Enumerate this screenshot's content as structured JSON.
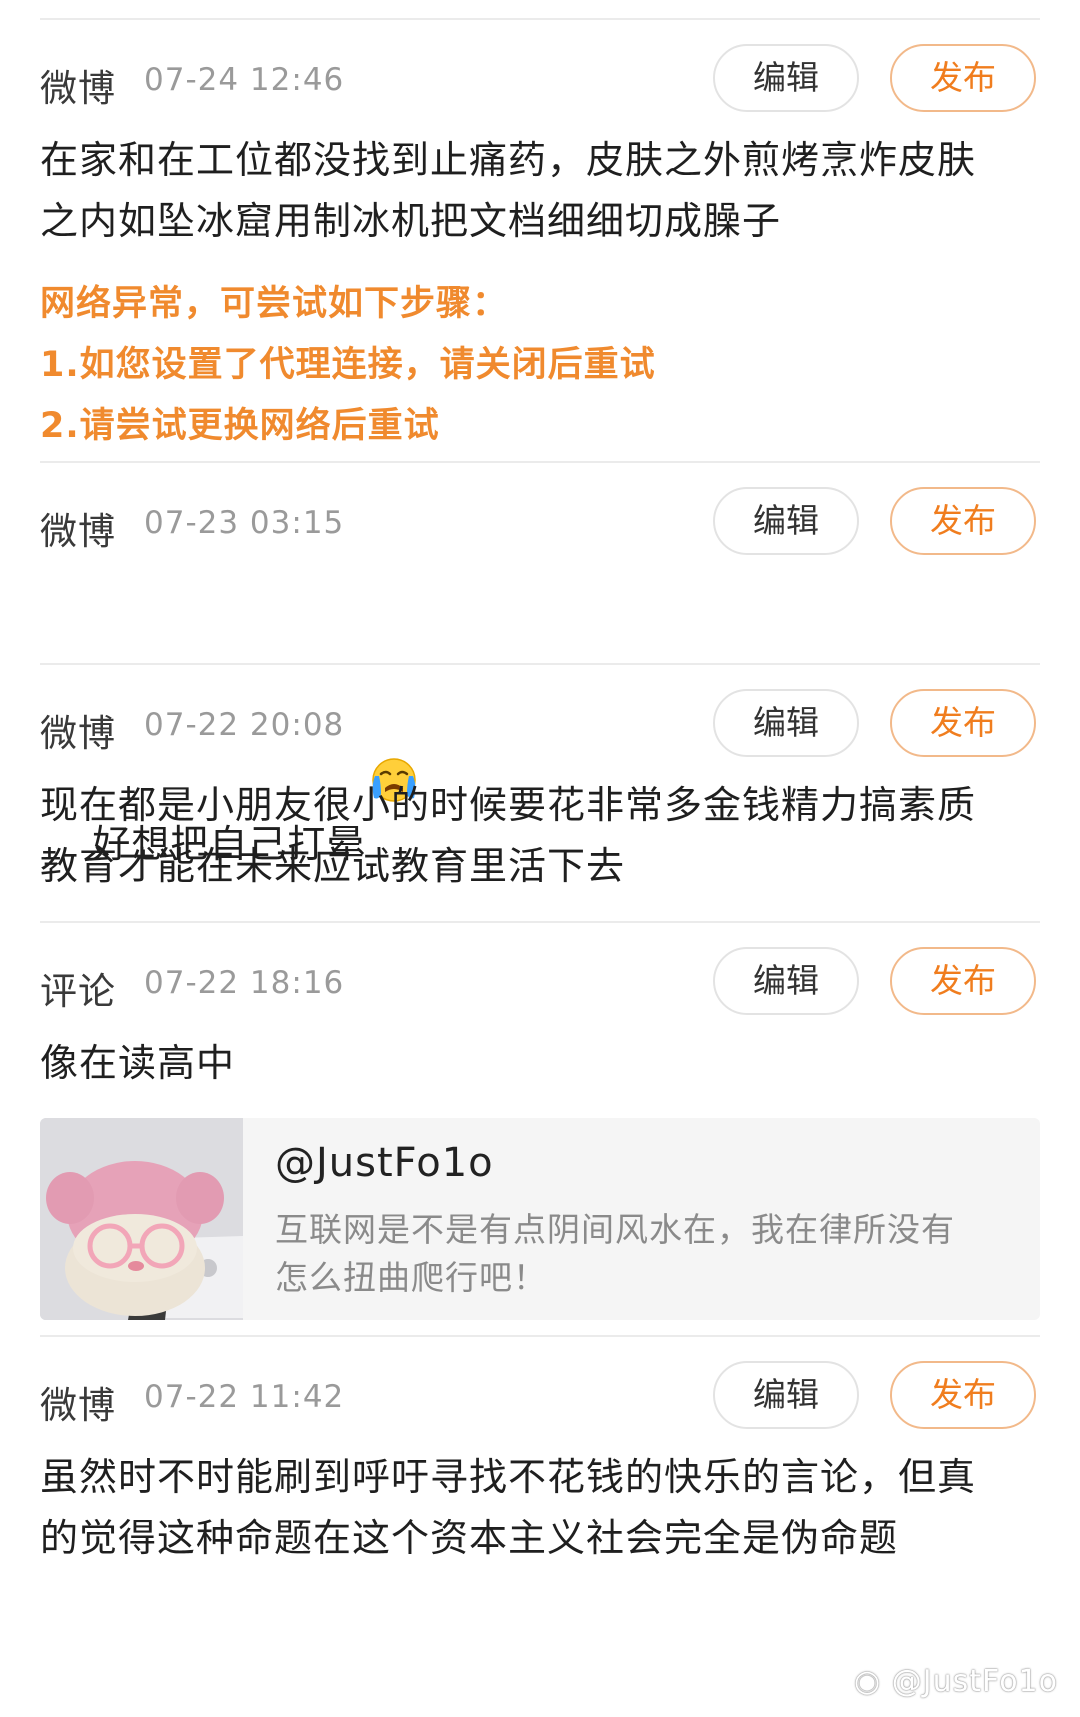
{
  "posts": [
    {
      "source": "微博",
      "time": "07-24 12:46",
      "edit_label": "编辑",
      "publish_label": "发布",
      "text": "在家和在工位都没找到止痛药，皮肤之外煎烤烹炸皮肤\n之内如坠冰窟用制冰机把文档细细切成臊子",
      "error": {
        "title": "网络异常，可尝试如下步骤：",
        "step1": "1.如您设置了代理连接，请关闭后重试",
        "step2": "2.请尝试更换网络后重试"
      }
    },
    {
      "source": "微博",
      "time": "07-23 03:15",
      "edit_label": "编辑",
      "publish_label": "发布",
      "text": "好想把自己打晕",
      "emoji": "crying-face-emoji"
    },
    {
      "source": "微博",
      "time": "07-22 20:08",
      "edit_label": "编辑",
      "publish_label": "发布",
      "text": "现在都是小朋友很小的时候要花非常多金钱精力搞素质\n教育才能在未来应试教育里活下去"
    },
    {
      "source": "评论",
      "time": "07-22 18:16",
      "edit_label": "编辑",
      "publish_label": "发布",
      "text": "像在读高中",
      "quote": {
        "author": "@JustFo1o",
        "text": "互联网是不是有点阴间风水在，我在律所没有\n怎么扭曲爬行吧！",
        "thumbnail": "pink-hat-plush-with-laptop"
      }
    },
    {
      "source": "微博",
      "time": "07-22 11:42",
      "edit_label": "编辑",
      "publish_label": "发布",
      "text": "虽然时不时能刷到呼吁寻找不花钱的快乐的言论，但真\n的觉得这种命题在这个资本主义社会完全是伪命题"
    }
  ],
  "watermark": "@JustFo1o",
  "colors": {
    "accent": "#f07d1e",
    "accent_border": "#f2b98a",
    "error_text": "#f08a2e",
    "meta_gray": "#9a9a9a",
    "divider": "#ebebeb",
    "quote_bg": "#f5f5f5"
  }
}
